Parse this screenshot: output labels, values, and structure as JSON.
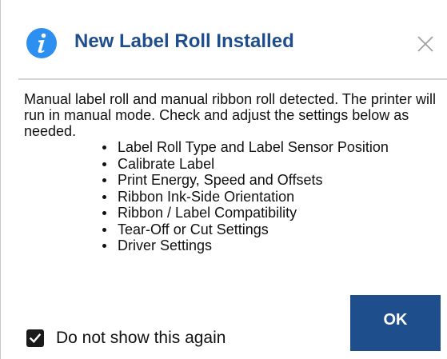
{
  "dialog": {
    "title": "New Label Roll Installed",
    "icon": "info-icon",
    "close_icon": "close-icon",
    "message": "Manual label roll and manual ribbon roll detected. The printer will run in manual mode. Check and adjust the settings below as needed.",
    "settings": [
      "Label Roll Type and Label Sensor Position",
      "Calibrate Label",
      "Print Energy, Speed and Offsets",
      "Ribbon Ink-Side Orientation",
      "Ribbon / Label Compatibility",
      "Tear-Off or Cut Settings",
      "Driver Settings"
    ],
    "checkbox_label": "Do not show this again",
    "checkbox_checked": true,
    "ok_label": "OK"
  },
  "colors": {
    "accent": "#1f4e8c",
    "info_icon": "#2d8ff0",
    "divider": "#d4d4d4"
  }
}
